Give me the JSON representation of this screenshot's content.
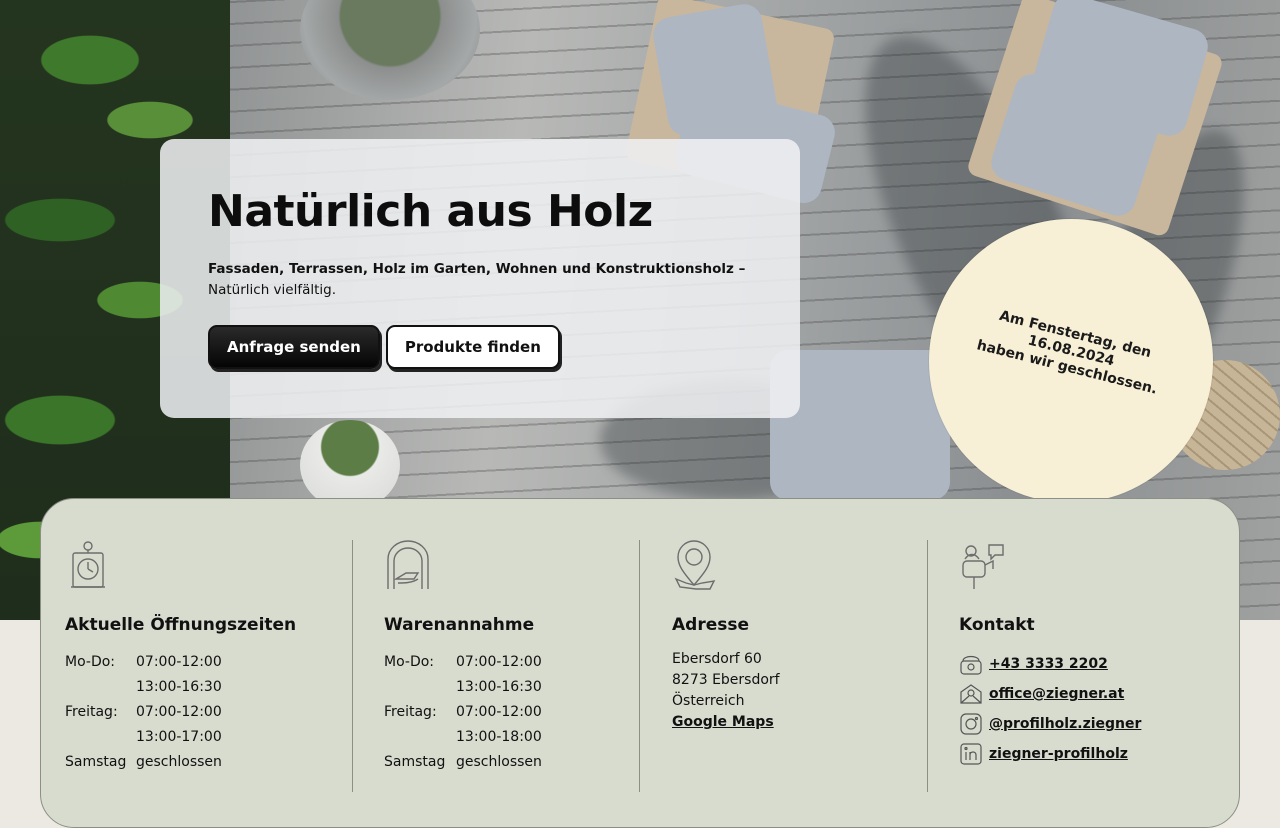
{
  "intro": {
    "title": "Natürlich aus Holz",
    "subtitle_bold": "Fassaden, Terrassen, Holz im Garten, Wohnen und Konstruktionsholz –",
    "subtitle_regular": "Natürlich vielfältig.",
    "primary_button": "Anfrage senden",
    "secondary_button": "Produkte finden"
  },
  "notice": {
    "line1": "Am Fenstertag, den 16.08.2024",
    "line2": "haben wir geschlossen."
  },
  "opening_hours": {
    "icon": "clock-icon",
    "heading": "Aktuelle Öffnungszeiten",
    "rows": [
      {
        "day": "Mo-Do:",
        "time": "07:00-12:00"
      },
      {
        "day": "",
        "time": "13:00-16:30"
      },
      {
        "day": "Freitag:",
        "time": "07:00-12:00"
      },
      {
        "day": "",
        "time": "13:00-17:00"
      },
      {
        "day": "Samstag",
        "time": "geschlossen"
      }
    ]
  },
  "goods_receiving": {
    "icon": "archway-icon",
    "heading": "Warenannahme",
    "rows": [
      {
        "day": "Mo-Do:",
        "time": "07:00-12:00"
      },
      {
        "day": "",
        "time": "13:00-16:30"
      },
      {
        "day": "Freitag:",
        "time": "07:00-12:00"
      },
      {
        "day": "",
        "time": "13:00-18:00"
      },
      {
        "day": "Samstag",
        "time": "geschlossen"
      }
    ]
  },
  "address": {
    "icon": "map-pin-icon",
    "heading": "Adresse",
    "street": "Ebersdorf 60",
    "city": "8273 Ebersdorf",
    "country": "Österreich",
    "maps_link": "Google Maps"
  },
  "contact": {
    "icon": "mailbox-icon",
    "heading": "Kontakt",
    "phone": "+43 3333 2202",
    "email": "office@ziegner.at",
    "instagram": "@profilholz.ziegner",
    "linkedin": "ziegner-profilholz"
  },
  "colors": {
    "panel": "#d8dccf",
    "notice": "#f7f0d7",
    "button_dark": "#111111"
  }
}
